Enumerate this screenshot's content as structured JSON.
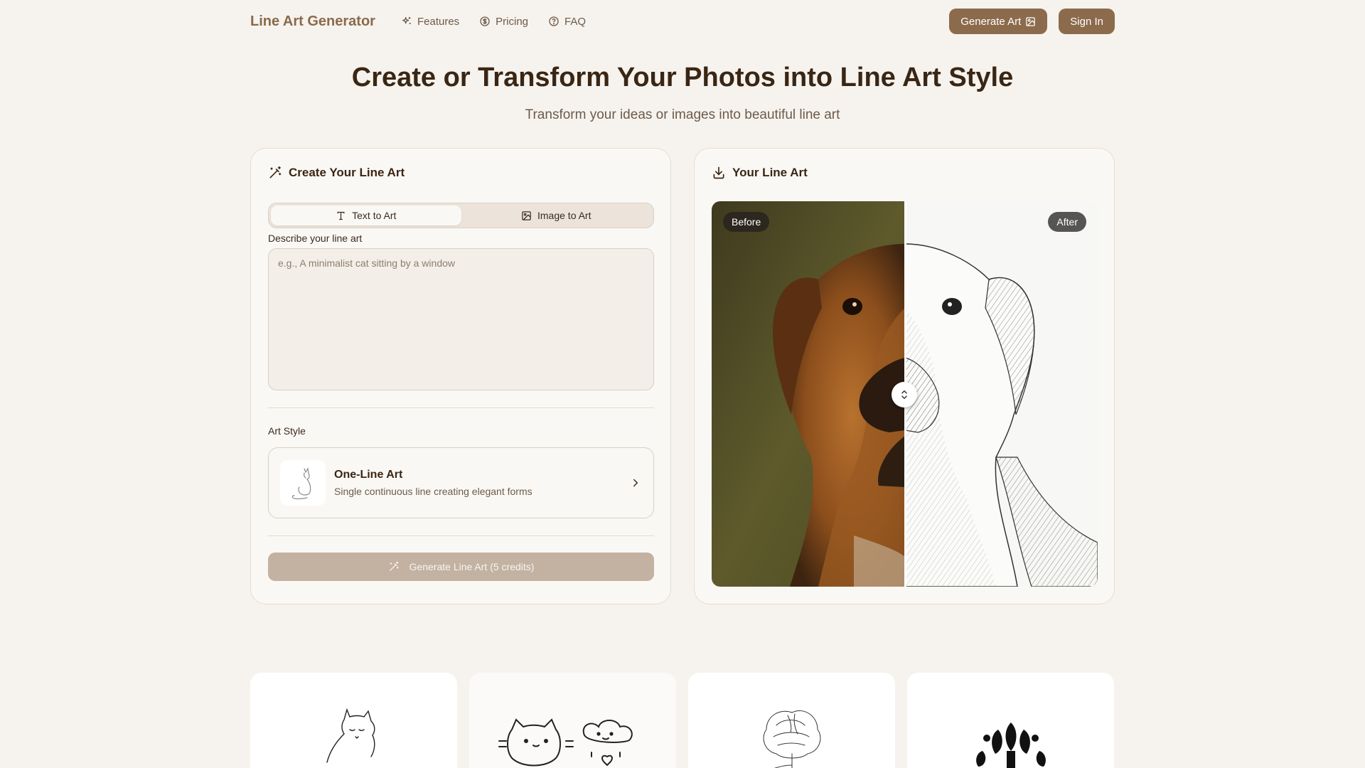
{
  "nav": {
    "brand": "Line Art Generator",
    "links": [
      {
        "label": "Features",
        "icon": "sparkles-icon"
      },
      {
        "label": "Pricing",
        "icon": "dollar-circle-icon"
      },
      {
        "label": "FAQ",
        "icon": "help-circle-icon"
      }
    ],
    "generate_label": "Generate Art",
    "signin_label": "Sign In"
  },
  "hero": {
    "title": "Create or Transform Your Photos into Line Art Style",
    "subtitle": "Transform your ideas or images into beautiful line art"
  },
  "create_card": {
    "title": "Create Your Line Art",
    "tabs": [
      {
        "label": "Text to Art",
        "active": true
      },
      {
        "label": "Image to Art",
        "active": false
      }
    ],
    "prompt_label": "Describe your line art",
    "prompt_placeholder": "e.g., A minimalist cat sitting by a window",
    "prompt_value": "",
    "style_label": "Art Style",
    "style": {
      "name": "One-Line Art",
      "description": "Single continuous line creating elegant forms"
    },
    "generate_button": "Generate Line Art (5 credits)"
  },
  "result_card": {
    "title": "Your Line Art",
    "before_label": "Before",
    "after_label": "After"
  },
  "gallery": [
    "cat-line-art",
    "cat-and-cloud-doodle",
    "peony-sketch",
    "folk-tulip-silhouette"
  ],
  "colors": {
    "accent": "#8c6a4c",
    "background": "#f6f3ee",
    "disabled_button": "#c3b2a2"
  }
}
